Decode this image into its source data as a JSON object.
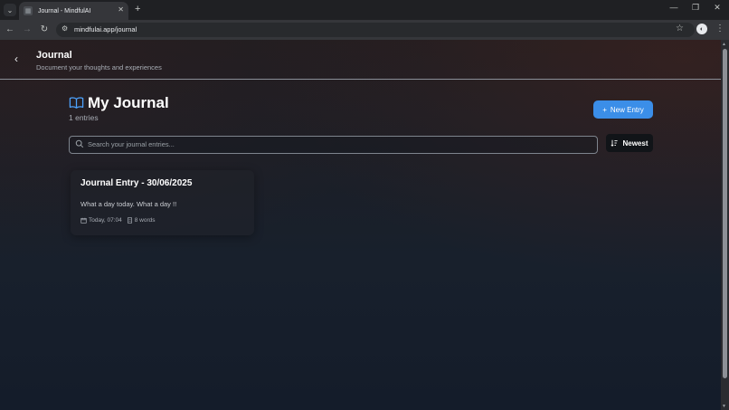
{
  "browser": {
    "tab_title": "Journal - MindfulAI",
    "url": "mindfulai.app/journal"
  },
  "header": {
    "title": "Journal",
    "subtitle": "Document your thoughts and experiences"
  },
  "main": {
    "title": "My Journal",
    "entry_count": "1 entries",
    "new_entry_label": "New Entry",
    "search_placeholder": "Search your journal entries...",
    "search_value": "",
    "sort_label": "Newest"
  },
  "entries": [
    {
      "title": "Journal Entry - 30/06/2025",
      "excerpt": "What a day today. What a day !!",
      "date": "Today, 07:04",
      "words": "8 words"
    }
  ],
  "colors": {
    "accent": "#3b8ee8",
    "background": "#1d1f24"
  },
  "icons": {
    "journal": "book-open-icon",
    "search": "search-icon",
    "sort": "sort-icon",
    "date": "calendar-icon",
    "words": "document-icon"
  }
}
